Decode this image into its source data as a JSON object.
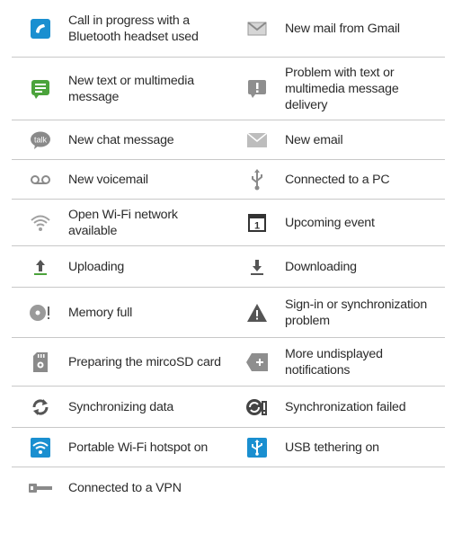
{
  "rows": [
    {
      "left": {
        "icon": "phone-bluetooth-icon",
        "label": "Call in progress with a Bluetooth headset used"
      },
      "right": {
        "icon": "gmail-icon",
        "label": "New mail from Gmail"
      }
    },
    {
      "left": {
        "icon": "text-message-icon",
        "label": "New text or multimedia message"
      },
      "right": {
        "icon": "message-problem-icon",
        "label": "Problem with text or multimedia message delivery"
      }
    },
    {
      "left": {
        "icon": "talk-icon",
        "label": "New chat message"
      },
      "right": {
        "icon": "email-icon",
        "label": "New email"
      }
    },
    {
      "left": {
        "icon": "voicemail-icon",
        "label": "New voicemail"
      },
      "right": {
        "icon": "usb-icon",
        "label": "Connected to a PC"
      }
    },
    {
      "left": {
        "icon": "wifi-open-icon",
        "label": "Open Wi-Fi network available"
      },
      "right": {
        "icon": "calendar-icon",
        "label": "Upcoming event"
      }
    },
    {
      "left": {
        "icon": "upload-icon",
        "label": "Uploading"
      },
      "right": {
        "icon": "download-icon",
        "label": "Downloading"
      }
    },
    {
      "left": {
        "icon": "memory-full-icon",
        "label": "Memory full"
      },
      "right": {
        "icon": "warning-icon",
        "label": "Sign-in or synchronization problem"
      }
    },
    {
      "left": {
        "icon": "sd-card-icon",
        "label": "Preparing the mircoSD card"
      },
      "right": {
        "icon": "more-notifications-icon",
        "label": "More undisplayed notifications"
      }
    },
    {
      "left": {
        "icon": "sync-icon",
        "label": "Synchronizing data"
      },
      "right": {
        "icon": "sync-failed-icon",
        "label": "Synchronization failed"
      }
    },
    {
      "left": {
        "icon": "wifi-hotspot-icon",
        "label": "Portable Wi-Fi hotspot on"
      },
      "right": {
        "icon": "usb-tethering-icon",
        "label": "USB tethering on"
      }
    },
    {
      "left": {
        "icon": "vpn-key-icon",
        "label": "Connected to a VPN"
      },
      "right": null
    }
  ],
  "colors": {
    "blue": "#1a8fd0",
    "green": "#4ba33b",
    "gray": "#8a8a8a",
    "divider": "#c8c8c8"
  }
}
